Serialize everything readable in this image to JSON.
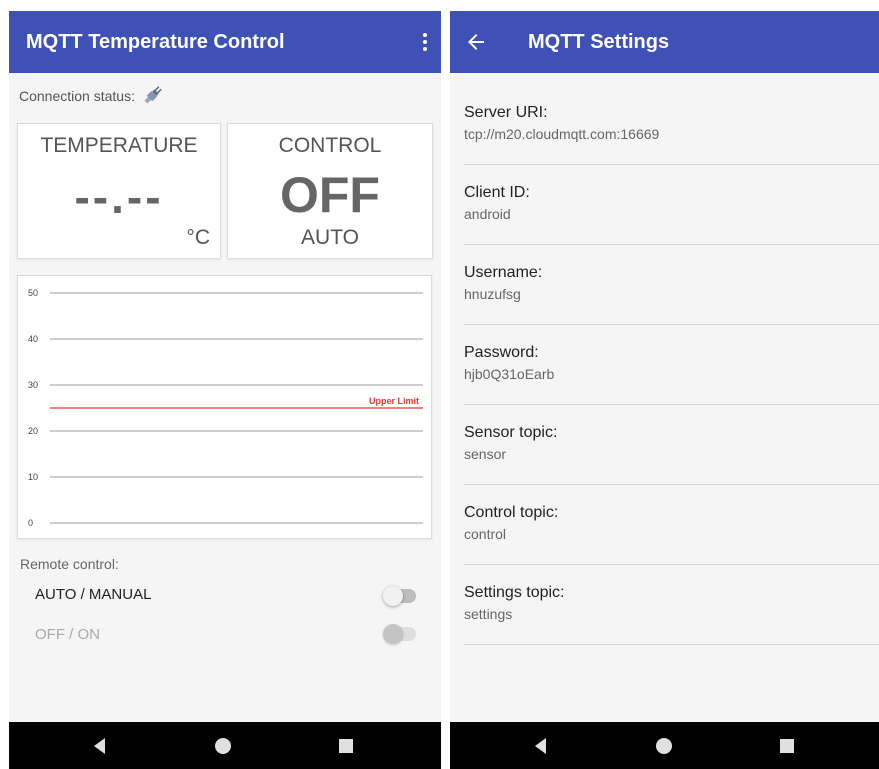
{
  "left_screen": {
    "app_title": "MQTT Temperature Control",
    "connection_label": "Connection status:",
    "temperature_card": {
      "title": "TEMPERATURE",
      "value": "--.--",
      "unit": "°C"
    },
    "control_card": {
      "title": "CONTROL",
      "state": "OFF",
      "mode": "AUTO"
    },
    "remote_control_label": "Remote control:",
    "switches": [
      {
        "label": "AUTO / MANUAL",
        "enabled": true,
        "checked": false
      },
      {
        "label": "OFF / ON",
        "enabled": false,
        "checked": false
      }
    ],
    "chart_data": {
      "type": "line",
      "y_ticks": [
        "0",
        "10",
        "20",
        "30",
        "40",
        "50"
      ],
      "ylim": [
        0,
        50
      ],
      "limit_line": {
        "label": "Upper Limit",
        "value": 25,
        "color": "#e53935"
      },
      "series": []
    }
  },
  "right_screen": {
    "app_title": "MQTT Settings",
    "settings": [
      {
        "title": "Server URI:",
        "summary": "tcp://m20.cloudmqtt.com:16669"
      },
      {
        "title": "Client ID:",
        "summary": "android"
      },
      {
        "title": "Username:",
        "summary": "hnuzufsg"
      },
      {
        "title": "Password:",
        "summary": "hjb0Q31oEarb"
      },
      {
        "title": "Sensor topic:",
        "summary": "sensor"
      },
      {
        "title": "Control topic:",
        "summary": "control"
      },
      {
        "title": "Settings topic:",
        "summary": "settings"
      }
    ]
  },
  "icons": {
    "overflow": "more-vert-icon",
    "back": "arrow-back-icon",
    "connection": "plug-icon",
    "nav": [
      "nav-back-icon",
      "nav-home-icon",
      "nav-recent-icon"
    ]
  },
  "colors": {
    "primary": "#3f51b5",
    "background": "#f5f5f5",
    "limit": "#e53935",
    "navbar": "#000000"
  }
}
